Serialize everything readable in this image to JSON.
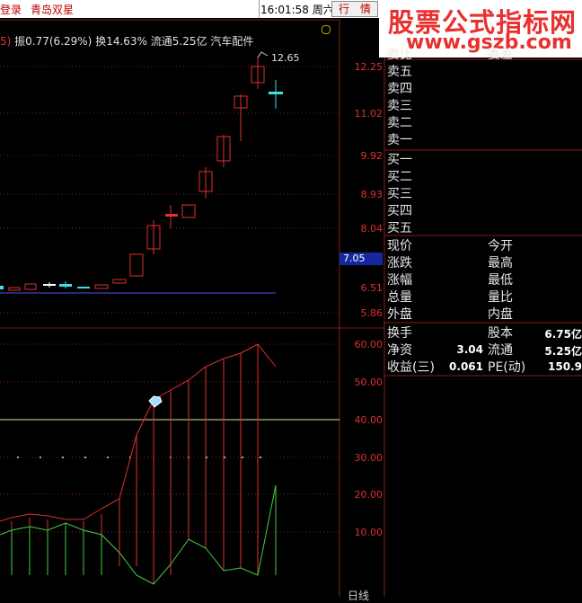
{
  "topbar": {
    "login": "登录",
    "stock_name": "青岛双星",
    "time": "16:01:58",
    "weekday": "周六",
    "quote_button": "行　情"
  },
  "watermark": {
    "title": "股票公式指标网",
    "url": "www.gszb.com"
  },
  "info_line": {
    "prefix": "5)",
    "amplitude": "振0.77(6.29%)",
    "turnover": "换14.63%",
    "float_cap": "流通5.25亿",
    "sector": "汽车配件"
  },
  "price_axis": {
    "labels": [
      "12.25",
      "11.02",
      "9.92",
      "8.93",
      "8.04",
      "6.51",
      "5.86"
    ],
    "high_marker": "12.65",
    "current_price": "7.05"
  },
  "indicator_axis": {
    "labels": [
      "60.00",
      "50.00",
      "40.00",
      "30.00",
      "20.00",
      "10.00"
    ]
  },
  "order_book": {
    "header": [
      "委比",
      "委差"
    ],
    "asks": [
      "卖五",
      "卖四",
      "卖三",
      "卖二",
      "卖一"
    ],
    "bids": [
      "买一",
      "买二",
      "买三",
      "买四",
      "买五"
    ]
  },
  "quote_fields": {
    "left": [
      "现价",
      "涨跌",
      "涨幅",
      "总量",
      "外盘"
    ],
    "right": [
      "今开",
      "最高",
      "最低",
      "量比",
      "内盘"
    ]
  },
  "fundamentals": {
    "rows": [
      {
        "l_label": "换手",
        "l_value": "",
        "r_label": "股本",
        "r_value": "6.75亿"
      },
      {
        "l_label": "净资",
        "l_value": "3.04",
        "r_label": "流通",
        "r_value": "5.25亿"
      },
      {
        "l_label": "收益(三)",
        "l_value": "0.061",
        "r_label": "PE(动)",
        "r_value": "150.9"
      }
    ]
  },
  "bottom_tab": "日线",
  "colors": {
    "up": "#e03030",
    "down": "#40e0e0",
    "grid": "#8b1a1a",
    "green_line": "#40d040",
    "level_line": "#e8e0a0"
  }
}
